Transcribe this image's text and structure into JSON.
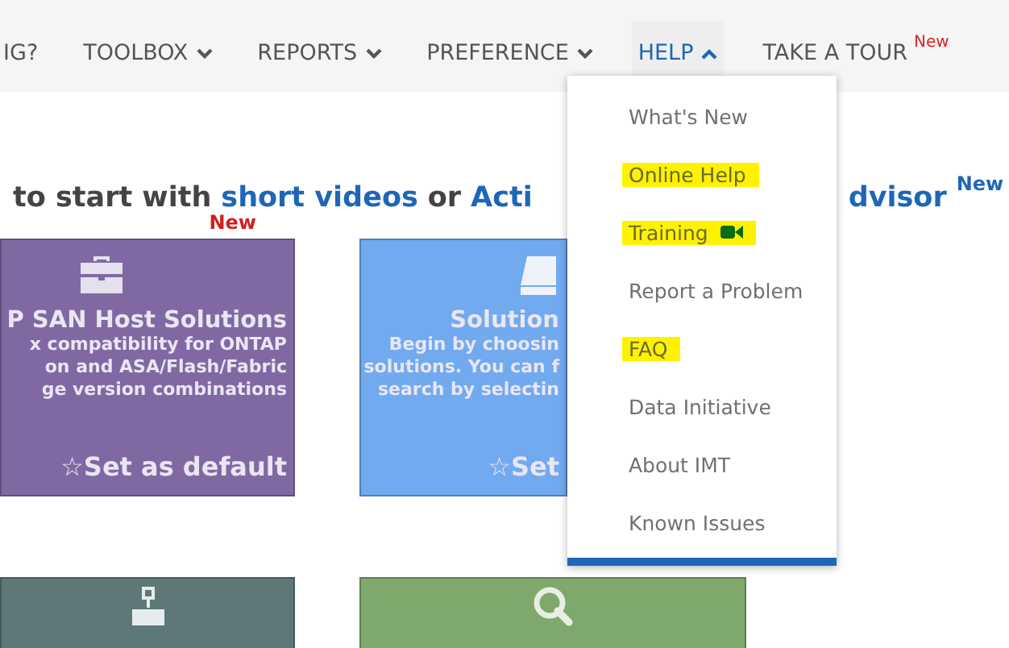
{
  "nav": [
    {
      "label": "IG?",
      "kind": "text"
    },
    {
      "label": "TOOLBOX",
      "kind": "dropdown",
      "selected": false,
      "expanded": false
    },
    {
      "label": "REPORTS",
      "kind": "dropdown",
      "selected": false,
      "expanded": false
    },
    {
      "label": "PREFERENCE",
      "kind": "dropdown",
      "selected": false,
      "expanded": false
    },
    {
      "label": "HELP",
      "kind": "dropdown",
      "selected": true,
      "expanded": true
    },
    {
      "label": "TAKE A TOUR",
      "kind": "link",
      "badge": "New"
    }
  ],
  "help_menu": [
    {
      "label": "What's New",
      "highlighted": false
    },
    {
      "label": "Online Help",
      "highlighted": true
    },
    {
      "label": "Training",
      "highlighted": true,
      "kind": "video"
    },
    {
      "label": "Report a Problem",
      "highlighted": false
    },
    {
      "label": "FAQ",
      "highlighted": true
    },
    {
      "label": "Data Initiative",
      "highlighted": false
    },
    {
      "label": "About IMT",
      "highlighted": false
    },
    {
      "label": "Known Issues",
      "highlighted": false
    }
  ],
  "heading": {
    "parts": [
      {
        "kind": "text",
        "text": "to start with"
      },
      {
        "kind": "link",
        "text": "short videos"
      },
      {
        "kind": "text",
        "text": "or"
      },
      {
        "kind": "link",
        "text": "Acti"
      },
      {
        "kind": "hidden"
      },
      {
        "kind": "link",
        "text": "dvisor"
      }
    ],
    "badge": "New"
  },
  "cards": [
    {
      "kind": "briefcase",
      "color": "#8069a3",
      "badge": "New",
      "title": "P SAN Host Solutions",
      "lines": [
        "x compatibility for ONTAP",
        "on and ASA/Flash/Fabric",
        "ge version combinations"
      ],
      "action": "☆Set as default"
    },
    {
      "kind": "drive",
      "color": "#72aaf0",
      "title": "Solution",
      "lines": [
        "Begin by choosin",
        "solutions. You can f",
        "search by selectin"
      ],
      "action": "☆Set"
    }
  ],
  "lower_cards": [
    {
      "kind": "network",
      "color": "#5e7878"
    },
    {
      "kind": "search",
      "color": "#7ea86c"
    }
  ]
}
